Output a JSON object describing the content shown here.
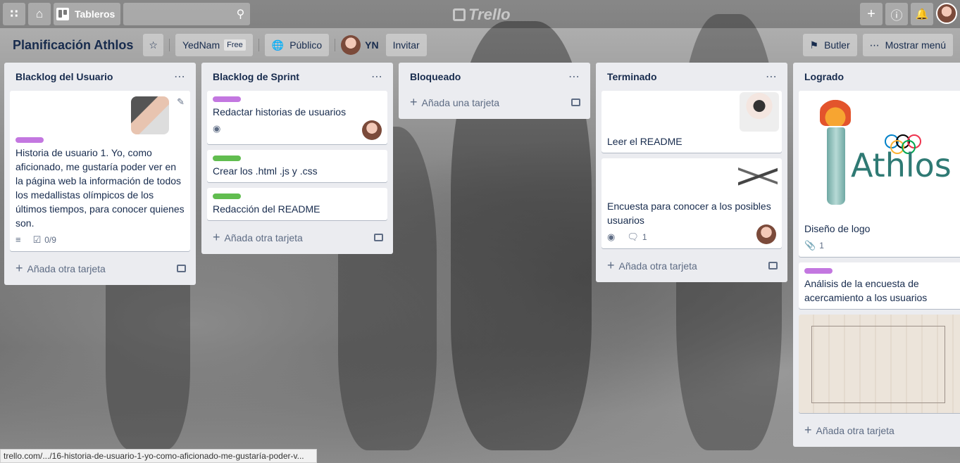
{
  "topbar": {
    "boards_label": "Tableros",
    "search_placeholder": "",
    "logo_text": "Trello"
  },
  "header": {
    "board_title": "Planificación Athlos",
    "team_name": "YedNam",
    "team_plan": "Free",
    "visibility": "Público",
    "member_initials": "YN",
    "invite_label": "Invitar",
    "butler_label": "Butler",
    "menu_label": "Mostrar menú"
  },
  "colors": {
    "purple_label": "#c377e0",
    "green_label": "#61bd4f"
  },
  "lists": [
    {
      "title": "Blacklog del Usuario",
      "cards": [
        {
          "text": "Historia de usuario 1. Yo, como aficionado, me gustaría poder ver en la página web la información de todos los medallistas olímpicos de los últimos tiempos, para conocer quienes son.",
          "checklist": "0/9"
        }
      ],
      "add_label": "Añada otra tarjeta"
    },
    {
      "title": "Blacklog de Sprint",
      "cards": [
        {
          "text": "Redactar historias de usuarios"
        },
        {
          "text": "Crear los .html .js y .css"
        },
        {
          "text": "Redacción del README"
        }
      ],
      "add_label": "Añada otra tarjeta"
    },
    {
      "title": "Bloqueado",
      "cards": [],
      "add_label": "Añada una tarjeta"
    },
    {
      "title": "Terminado",
      "cards": [
        {
          "text": "Leer el README"
        },
        {
          "text": "Encuesta para conocer a los posibles usuarios",
          "comments": "1"
        }
      ],
      "add_label": "Añada otra tarjeta"
    },
    {
      "title": "Logrado",
      "cards": [
        {
          "text": "Diseño de logo",
          "attachments": "1",
          "logo_word": "Athlos"
        },
        {
          "text": "Análisis de la encuesta de acercamiento a los usuarios"
        }
      ],
      "add_label": "Añada otra tarjeta"
    }
  ],
  "status_url": "trello.com/.../16-historia-de-usuario-1-yo-como-aficionado-me-gustaría-poder-v..."
}
